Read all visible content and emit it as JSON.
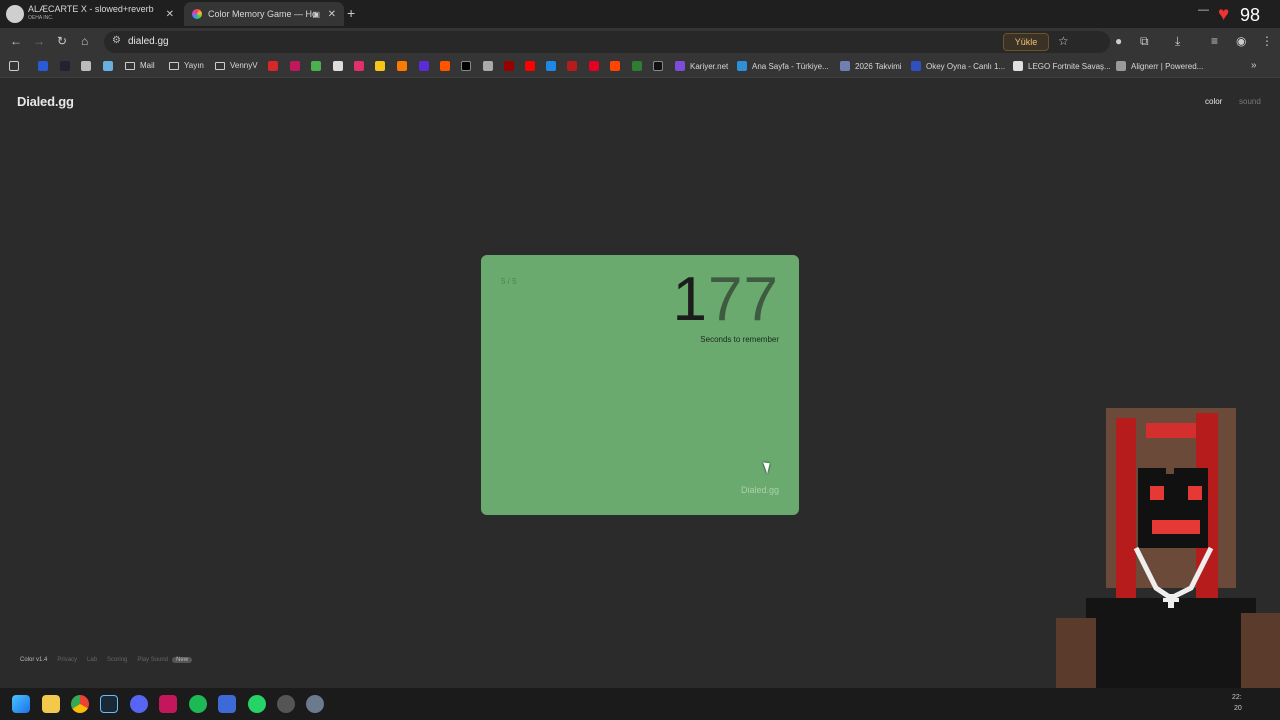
{
  "browser": {
    "tabs": [
      {
        "title": "ALÆCARTE X - slowed+reverb",
        "subtitle": "OEHA INC.",
        "close": "✕"
      },
      {
        "title": "Color Memory Game — Ho",
        "close": "✕"
      }
    ],
    "new_tab": "+",
    "minimize": "—",
    "heart_icon": "♥",
    "heart_counter": "98",
    "url": "dialed.gg",
    "upload_label": "Yükle",
    "bookmarks": [
      {
        "label": "Mail",
        "kind": "folder"
      },
      {
        "label": "Yayın",
        "kind": "folder"
      },
      {
        "label": "VennyV",
        "kind": "folder"
      },
      {
        "label": "Kariyer.net",
        "kind": "site",
        "color": "#7b4dd8"
      },
      {
        "label": "Ana Sayfa - Türkiye...",
        "kind": "site",
        "color": "#2f8fd8"
      },
      {
        "label": "2026 Takvimi",
        "kind": "site",
        "color": "#7080b0"
      },
      {
        "label": "Okey Oyna - Canlı 1...",
        "kind": "site",
        "color": "#3050c0"
      },
      {
        "label": "LEGO Fortnite Savaş...",
        "kind": "site",
        "color": "#e0e0e0"
      },
      {
        "label": "Alignerr | Powered...",
        "kind": "site",
        "color": "#9a9a9a"
      }
    ]
  },
  "page": {
    "logo": "Dialed.gg",
    "modes": {
      "color": "color",
      "sound": "sound"
    },
    "card": {
      "round": "5 / 5",
      "countdown_digit_1": "1",
      "countdown_digit_2": "77",
      "caption": "Seconds to remember",
      "brand": "Dialed.gg",
      "color": "#6aaa6e"
    },
    "footer": {
      "version": "Color v1.4",
      "links": [
        "Privacy",
        "Lab",
        "Scoring",
        "Play Sound"
      ],
      "new_badge": "New"
    }
  },
  "taskbar": {
    "clock_time": "22:",
    "clock_date": "20"
  }
}
